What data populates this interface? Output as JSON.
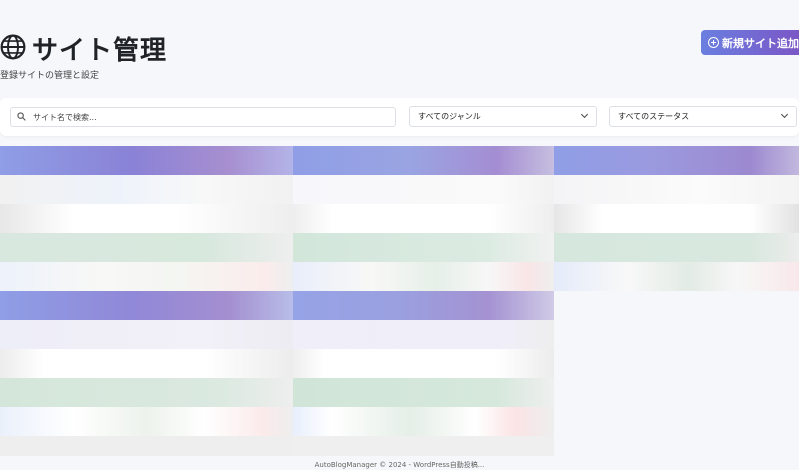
{
  "page": {
    "title": "サイト管理",
    "subtitle": "登録サイトの管理と設定",
    "title_icon": "globe-icon"
  },
  "actions": {
    "new_site_label": "新規サイト追加",
    "new_site_icon": "plus-circle-icon"
  },
  "filters": {
    "search_placeholder": "サイト名で検索...",
    "search_value": "",
    "genre_selected": "すべてのジャンル",
    "status_selected": "すべてのステータス",
    "search_icon": "search-icon",
    "dropdown_icon": "chevron-down-icon"
  },
  "theme": {
    "accent_start": "#6a7fe0",
    "accent_end": "#7b56c6",
    "page_bg": "#f6f7fa",
    "row_white": "#ffffff",
    "row_grey": "#ececec",
    "row_green": "#d9e9df",
    "row_tint": "#eef2fb"
  },
  "footer": {
    "text": "AutoBlogManager © 2024 - WordPress自動投稿..."
  }
}
